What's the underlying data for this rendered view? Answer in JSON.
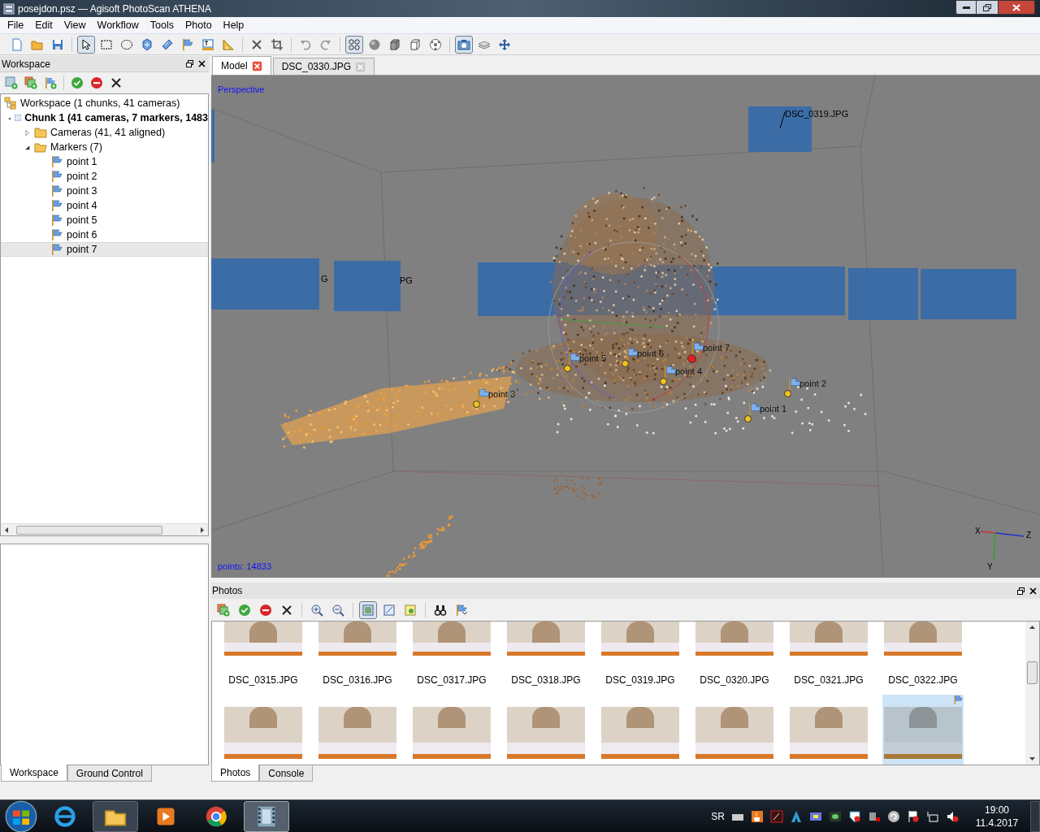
{
  "window": {
    "title": "posejdon.psz — Agisoft PhotoScan ATHENA"
  },
  "menu": [
    "File",
    "Edit",
    "View",
    "Workflow",
    "Tools",
    "Photo",
    "Help"
  ],
  "toolbar": [
    {
      "selected": false
    },
    {
      "selected": false
    },
    {
      "selected": false
    },
    {
      "selected": true
    },
    {
      "selected": false
    },
    {
      "selected": false
    },
    {
      "selected": false
    },
    {
      "selected": false
    },
    {
      "selected": false
    },
    {
      "selected": false
    },
    {
      "selected": false
    },
    {
      "selected": false
    },
    {
      "selected": false
    },
    {
      "selected": false
    },
    {
      "selected": false
    },
    {
      "selected": true
    },
    {
      "selected": false
    },
    {
      "selected": false
    },
    {
      "selected": false
    },
    {
      "selected": false
    },
    {
      "selected": true
    },
    {
      "selected": false
    },
    {
      "selected": false
    }
  ],
  "workspace": {
    "title": "Workspace",
    "tree": {
      "label": "Workspace (1 chunks, 41 cameras)",
      "children": [
        {
          "label": "Chunk 1 (41 cameras, 7 markers, 1483",
          "expanded": true,
          "children": [
            {
              "label": "Cameras (41, 41 aligned)",
              "expanded": false
            },
            {
              "label": "Markers (7)",
              "expanded": true,
              "children": [
                {
                  "label": "point 1",
                  "selected": false
                },
                {
                  "label": "point 2",
                  "selected": false
                },
                {
                  "label": "point 3",
                  "selected": false
                },
                {
                  "label": "point 4",
                  "selected": false
                },
                {
                  "label": "point 5",
                  "selected": false
                },
                {
                  "label": "point 6",
                  "selected": false
                },
                {
                  "label": "point 7",
                  "selected": true
                }
              ]
            }
          ]
        }
      ]
    },
    "tabs": [
      {
        "label": "Workspace",
        "selected": true
      },
      {
        "label": "Ground Control",
        "selected": false
      }
    ]
  },
  "view_tabs": [
    {
      "label": "Model",
      "selected": true
    },
    {
      "label": "DSC_0330.JPG",
      "selected": false
    }
  ],
  "viewport": {
    "projection": "Perspective",
    "points": "points: 14833",
    "camera_labels": [
      "DSC_0319.JPG",
      "G",
      "PG"
    ],
    "markers": [
      {
        "label": "point 1",
        "selected": false
      },
      {
        "label": "point 2",
        "selected": false
      },
      {
        "label": "point 3",
        "selected": false
      },
      {
        "label": "point 4",
        "selected": false
      },
      {
        "label": "point 5",
        "selected": false
      },
      {
        "label": "point 6",
        "selected": false
      },
      {
        "label": "point 7",
        "selected": true
      }
    ],
    "axes": [
      "X",
      "Z",
      "Y"
    ]
  },
  "photos": {
    "title": "Photos",
    "toolbar": [
      {
        "selected": false
      },
      {
        "selected": false
      },
      {
        "selected": false
      },
      {
        "selected": false
      },
      {
        "selected": false
      },
      {
        "selected": false
      },
      {
        "selected": true
      },
      {
        "selected": false
      },
      {
        "selected": false
      },
      {
        "selected": false
      },
      {
        "selected": false
      }
    ],
    "rows": [
      [
        {
          "label": "DSC_0315.JPG",
          "selected": false
        },
        {
          "label": "DSC_0316.JPG",
          "selected": false
        },
        {
          "label": "DSC_0317.JPG",
          "selected": false
        },
        {
          "label": "DSC_0318.JPG",
          "selected": false
        },
        {
          "label": "DSC_0319.JPG",
          "selected": false
        },
        {
          "label": "DSC_0320.JPG",
          "selected": false
        },
        {
          "label": "DSC_0321.JPG",
          "selected": false
        },
        {
          "label": "DSC_0322.JPG",
          "selected": false
        }
      ],
      [
        {
          "selected": false
        },
        {
          "selected": false
        },
        {
          "selected": false
        },
        {
          "selected": false
        },
        {
          "selected": false
        },
        {
          "selected": false
        },
        {
          "selected": false
        },
        {
          "selected": true
        }
      ]
    ],
    "tabs": [
      {
        "label": "Photos",
        "selected": true
      },
      {
        "label": "Console",
        "selected": false
      }
    ]
  },
  "taskbar": {
    "language": "SR",
    "time": "19:00",
    "date": "11.4.2017"
  }
}
